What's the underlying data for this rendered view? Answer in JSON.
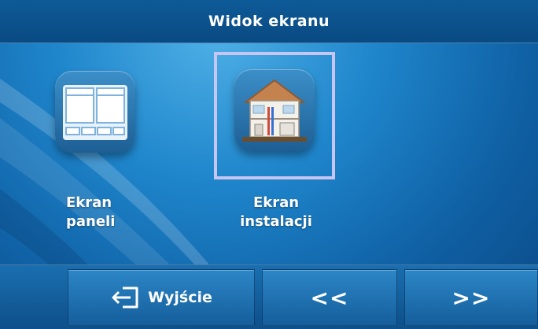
{
  "header": {
    "title": "Widok ekranu"
  },
  "tiles": [
    {
      "label_line1": "Ekran",
      "label_line2": "paneli",
      "icon": "panel-view-icon",
      "selected": false
    },
    {
      "label_line1": "Ekran",
      "label_line2": "instalacji",
      "icon": "house-installation-icon",
      "selected": true
    }
  ],
  "footer": {
    "exit_label": "Wyjście",
    "exit_icon": "exit-door-arrow-icon",
    "prev_label": "<<",
    "next_label": ">>"
  },
  "colors": {
    "background": "#1f86cc",
    "selection_frame": "#c7c6f2",
    "text": "#ffffff"
  }
}
